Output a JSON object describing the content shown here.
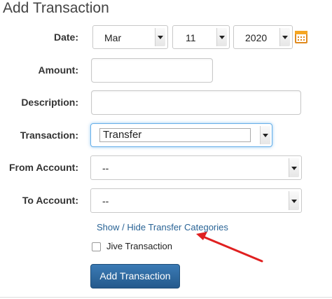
{
  "form": {
    "title": "Add Transaction",
    "labels": {
      "date": "Date:",
      "amount": "Amount:",
      "description": "Description:",
      "transaction": "Transaction:",
      "from_account": "From Account:",
      "to_account": "To Account:"
    },
    "date": {
      "month": "Mar",
      "day": "11",
      "year": "2020"
    },
    "amount": {
      "value": ""
    },
    "description": {
      "value": ""
    },
    "transaction_type": "Transfer",
    "from_account": "--",
    "to_account": "--",
    "toggle_link": "Show / Hide Transfer Categories",
    "jive_label": "Jive Transaction",
    "jive_checked": false,
    "submit_label": "Add Transaction"
  },
  "annotation": {
    "arrow_color": "#e02020",
    "icon": "arrow-annotation"
  },
  "colors": {
    "button": "#2a6496",
    "link": "#2a6496",
    "focus": "#66afe9"
  }
}
